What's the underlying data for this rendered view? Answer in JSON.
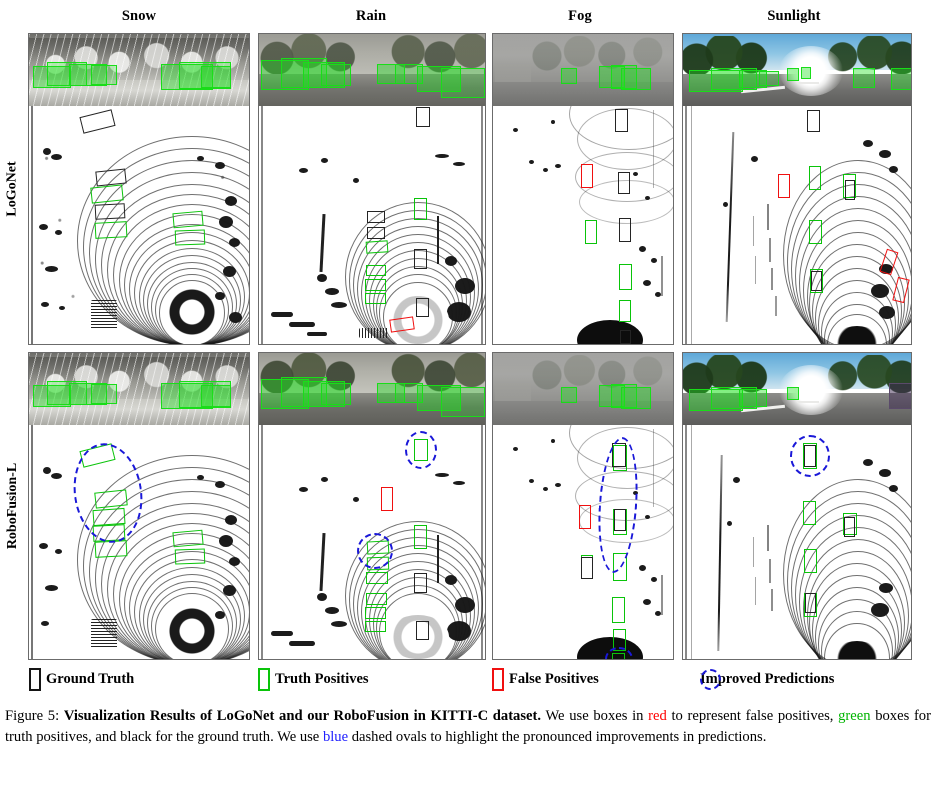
{
  "figure": {
    "id": "Figure 5",
    "columns": [
      {
        "key": "snow",
        "label": "Snow"
      },
      {
        "key": "rain",
        "label": "Rain"
      },
      {
        "key": "fog",
        "label": "Fog"
      },
      {
        "key": "sunlight",
        "label": "Sunlight"
      }
    ],
    "rows": [
      {
        "key": "logonet",
        "label": "LoGoNet"
      },
      {
        "key": "robofusion",
        "label": "RoboFusion-L"
      }
    ]
  },
  "legend": {
    "items": [
      {
        "key": "ground-truth",
        "label": "Ground Truth",
        "color": "#151515",
        "shape": "rect"
      },
      {
        "key": "truth-positives",
        "label": "Truth Positives",
        "color": "#0ac40a",
        "shape": "rect"
      },
      {
        "key": "false-positives",
        "label": "False Positives",
        "color": "#f01010",
        "shape": "rect"
      },
      {
        "key": "improved-predictions",
        "label": "Improved  Predictions",
        "color": "#1a18d8",
        "shape": "dashed-oval"
      }
    ]
  },
  "caption": {
    "prefix": "Figure 5: ",
    "bold_title": "Visualization Results of LoGoNet and our RoboFusion in KITTI-C dataset.",
    "part1": " We use boxes in ",
    "red_word": "red",
    "part2": " to represent false positives, ",
    "green_word": "green",
    "part3": " boxes for truth positives, and black for the ground truth. We use ",
    "blue_word": "blue",
    "part4": " dashed ovals to highlight the pronounced improvements in predictions."
  },
  "colors": {
    "ground_truth": "#242424",
    "truth_positive": "#0ac40a",
    "false_positive": "#f01010",
    "improved": "#1a18d8",
    "camera_box": "#19dd19"
  },
  "panels": {
    "snow_logonet": {
      "condition": "Snow",
      "model": "LoGoNet",
      "camera_style": "snowy-desaturated",
      "counts": {
        "ground_truth": 3,
        "truth_positives": 4,
        "false_positives": 0,
        "improved_ovals": 0
      }
    },
    "rain_logonet": {
      "condition": "Rain",
      "model": "LoGoNet",
      "camera_style": "rain-desaturated",
      "counts": {
        "ground_truth": 4,
        "truth_positives": 5,
        "false_positives": 1,
        "improved_ovals": 0
      }
    },
    "fog_logonet": {
      "condition": "Fog",
      "model": "LoGoNet",
      "camera_style": "fog-grey",
      "counts": {
        "ground_truth": 4,
        "truth_positives": 3,
        "false_positives": 1,
        "improved_ovals": 0
      }
    },
    "sunlight_logonet": {
      "condition": "Sunlight",
      "model": "LoGoNet",
      "camera_style": "sunlight-color",
      "counts": {
        "ground_truth": 2,
        "truth_positives": 4,
        "false_positives": 3,
        "improved_ovals": 0
      }
    },
    "snow_robofusion": {
      "condition": "Snow",
      "model": "RoboFusion-L",
      "camera_style": "snowy-desaturated",
      "counts": {
        "ground_truth": 0,
        "truth_positives": 7,
        "false_positives": 0,
        "improved_ovals": 1
      }
    },
    "rain_robofusion": {
      "condition": "Rain",
      "model": "RoboFusion-L",
      "camera_style": "rain-desaturated",
      "counts": {
        "ground_truth": 2,
        "truth_positives": 8,
        "false_positives": 1,
        "improved_ovals": 2
      }
    },
    "fog_robofusion": {
      "condition": "Fog",
      "model": "RoboFusion-L",
      "camera_style": "fog-grey",
      "counts": {
        "ground_truth": 2,
        "truth_positives": 7,
        "false_positives": 1,
        "improved_ovals": 2
      }
    },
    "sunlight_robofusion": {
      "condition": "Sunlight",
      "model": "RoboFusion-L",
      "camera_style": "sunlight-color",
      "counts": {
        "ground_truth": 1,
        "truth_positives": 4,
        "false_positives": 0,
        "improved_ovals": 1
      }
    }
  }
}
